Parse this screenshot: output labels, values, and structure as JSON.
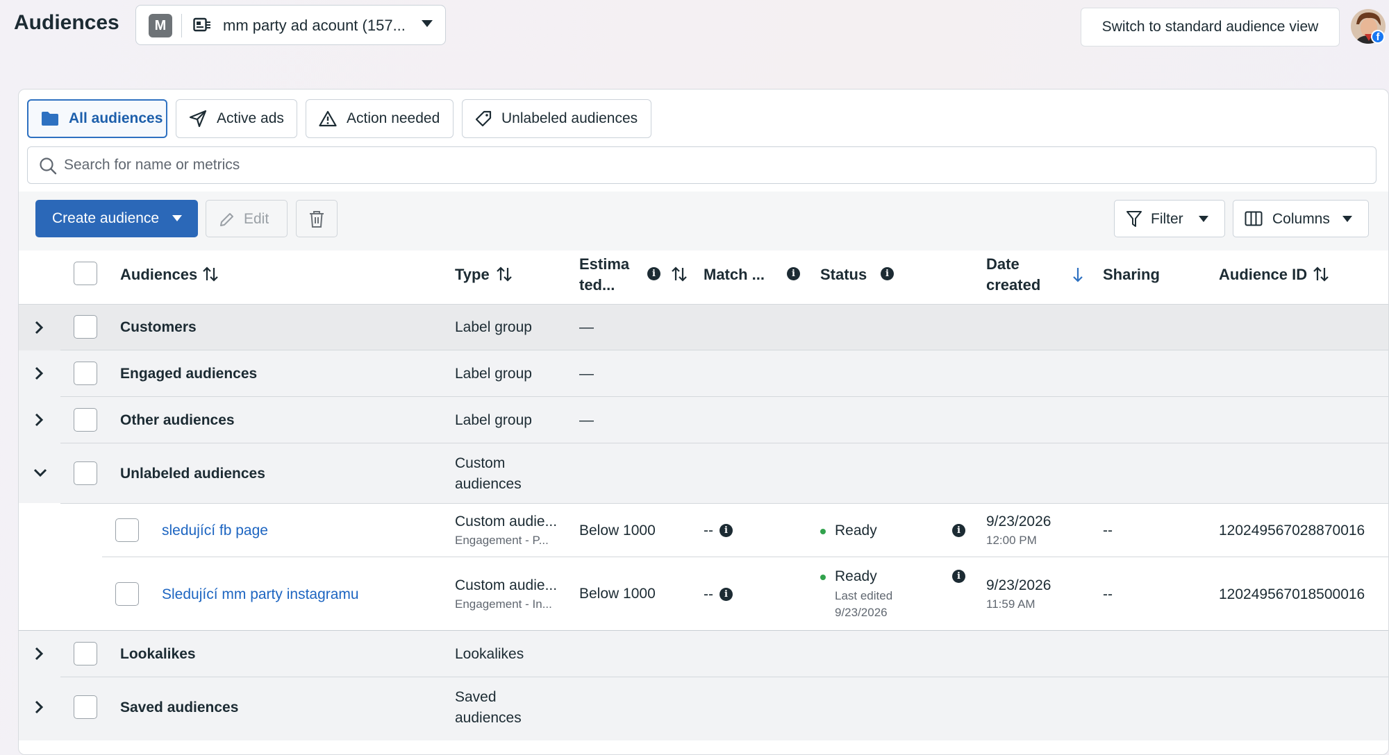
{
  "header": {
    "title": "Audiences",
    "account": {
      "badge": "M",
      "name": "mm party ad acount (157..."
    },
    "switch_label": "Switch to standard audience view"
  },
  "tabs": [
    {
      "label": "All audiences",
      "icon": "folder-icon",
      "active": true
    },
    {
      "label": "Active ads",
      "icon": "send-icon",
      "active": false
    },
    {
      "label": "Action needed",
      "icon": "warning-icon",
      "active": false
    },
    {
      "label": "Unlabeled audiences",
      "icon": "tag-icon",
      "active": false
    }
  ],
  "search": {
    "placeholder": "Search for name or metrics"
  },
  "toolbar": {
    "create_label": "Create audience",
    "edit_label": "Edit",
    "filter_label": "Filter",
    "columns_label": "Columns"
  },
  "columns": {
    "audiences": "Audiences",
    "type": "Type",
    "estimated_1": "Estima",
    "estimated_2": "ted...",
    "match": "Match ...",
    "status": "Status",
    "date_1": "Date",
    "date_2": "created",
    "sharing": "Sharing",
    "audience_id": "Audience ID"
  },
  "rows": [
    {
      "name": "Customers",
      "type": "Label group",
      "size": "—"
    },
    {
      "name": "Engaged audiences",
      "type": "Label group",
      "size": "—"
    },
    {
      "name": "Other audiences",
      "type": "Label group",
      "size": "—"
    },
    {
      "name": "Unlabeled audiences",
      "type_1": "Custom",
      "type_2": "audiences"
    },
    {
      "name": "sledující fb page",
      "type": "Custom audie...",
      "type_sub": "Engagement - P...",
      "size": "Below 1000",
      "match": "--",
      "status": "Ready",
      "date": "9/23/2026",
      "time": "12:00 PM",
      "sharing": "--",
      "id": "120249567028870016"
    },
    {
      "name": "Sledující mm party instagramu",
      "type": "Custom audie...",
      "type_sub": "Engagement - In...",
      "size": "Below 1000",
      "match": "--",
      "status": "Ready",
      "status_sub_1": "Last edited",
      "status_sub_2": "9/23/2026",
      "date": "9/23/2026",
      "time": "11:59 AM",
      "sharing": "--",
      "id": "120249567018500016"
    },
    {
      "name": "Lookalikes",
      "type": "Lookalikes"
    },
    {
      "name": "Saved audiences",
      "type_1": "Saved",
      "type_2": "audiences"
    }
  ]
}
